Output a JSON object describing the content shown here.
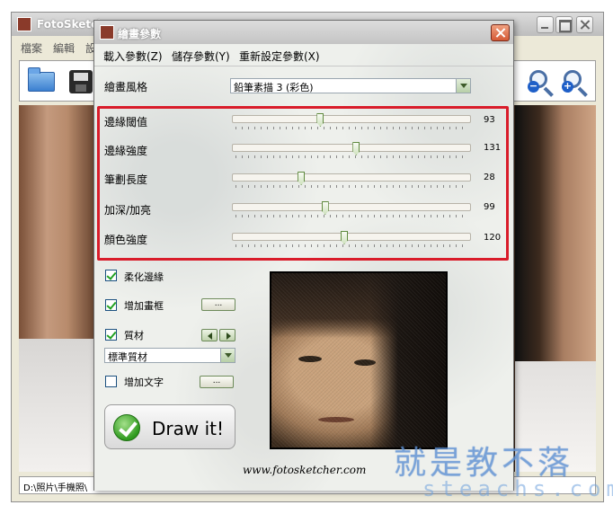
{
  "main_window": {
    "title": "FotoSketcher",
    "menu": [
      "檔案",
      "編輯",
      "設"
    ],
    "status_path": "D:\\照片\\手機照\\"
  },
  "dialog": {
    "title": "繪畫參數",
    "menu": [
      "載入參數(Z)",
      "儲存參數(Y)",
      "重新設定參數(X)"
    ],
    "style_label": "繪畫風格",
    "style_value": "鉛筆素描 3 (彩色)",
    "sliders": [
      {
        "label": "邊緣閾值",
        "value": "93",
        "position": 0.37
      },
      {
        "label": "邊緣強度",
        "value": "131",
        "position": 0.52
      },
      {
        "label": "筆劃長度",
        "value": "28",
        "position": 0.29
      },
      {
        "label": "加深/加亮",
        "value": "99",
        "position": 0.39
      },
      {
        "label": "顏色強度",
        "value": "120",
        "position": 0.47
      }
    ],
    "options": {
      "soften_edges": {
        "label": "柔化邊緣",
        "checked": true
      },
      "add_frame": {
        "label": "增加畫框",
        "checked": true,
        "button": "..."
      },
      "texture": {
        "label": "質材",
        "checked": true
      },
      "texture_select": "標準質材",
      "add_text": {
        "label": "增加文字",
        "checked": false,
        "button": "..."
      }
    },
    "draw_button": "Draw it!",
    "website": "www.fotosketcher.com"
  },
  "watermark": {
    "cn": "就是教不落",
    "en": "steachs.com"
  },
  "colors": {
    "highlight": "#d91c2a",
    "accent_green": "#2e9a1e"
  }
}
